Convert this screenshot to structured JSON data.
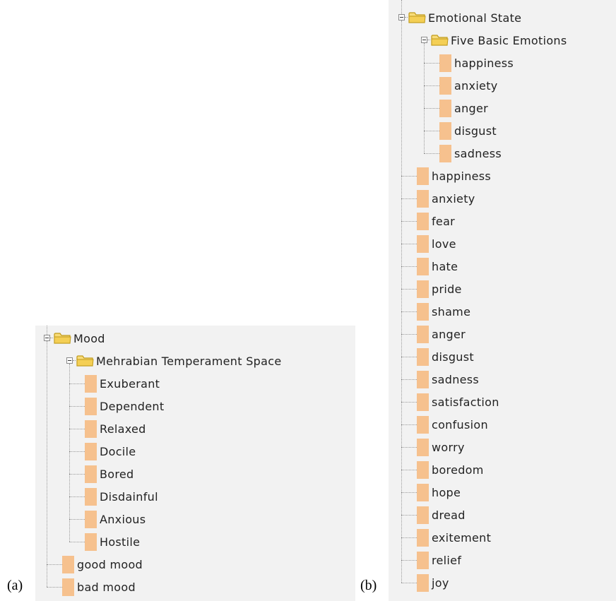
{
  "labels": {
    "a": "(a)",
    "b": "(b)"
  },
  "colors": {
    "panel_bg": "#f2f2f2",
    "leaf_square": "#f6c18e",
    "folder_fill": "#f8dc7a",
    "folder_stroke": "#c09a1a",
    "text": "#222222"
  },
  "panel_a": {
    "root": "Mood",
    "group": "Mehrabian Temperament Space",
    "group_items": [
      "Exuberant",
      "Dependent",
      "Relaxed",
      "Docile",
      "Bored",
      "Disdainful",
      "Anxious",
      "Hostile"
    ],
    "items": [
      "good mood",
      "bad mood"
    ]
  },
  "panel_b": {
    "root": "Emotional State",
    "group": "Five Basic Emotions",
    "group_items": [
      "happiness",
      "anxiety",
      "anger",
      "disgust",
      "sadness"
    ],
    "items": [
      "happiness",
      "anxiety",
      "fear",
      "love",
      "hate",
      "pride",
      "shame",
      "anger",
      "disgust",
      "sadness",
      "satisfaction",
      "confusion",
      "worry",
      "boredom",
      "hope",
      "dread",
      "exitement",
      "relief",
      "joy"
    ]
  }
}
